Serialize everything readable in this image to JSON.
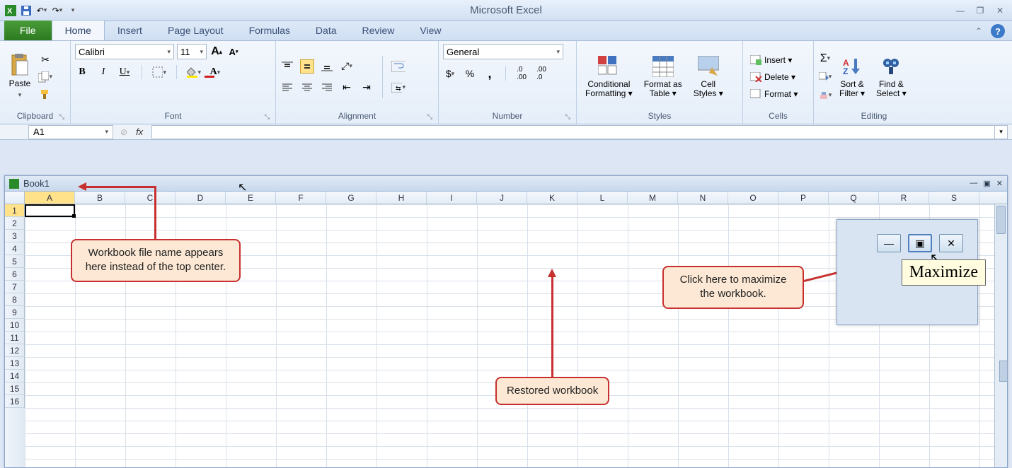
{
  "app": {
    "title": "Microsoft Excel"
  },
  "tabs": {
    "file": "File",
    "items": [
      "Home",
      "Insert",
      "Page Layout",
      "Formulas",
      "Data",
      "Review",
      "View"
    ],
    "active": "Home"
  },
  "ribbon": {
    "clipboard": {
      "paste": "Paste",
      "label": "Clipboard"
    },
    "font": {
      "name": "Calibri",
      "size": "11",
      "label": "Font"
    },
    "alignment": {
      "label": "Alignment"
    },
    "number": {
      "format": "General",
      "label": "Number"
    },
    "styles": {
      "conditional": "Conditional\nFormatting ▾",
      "format_table": "Format as\nTable ▾",
      "cell_styles": "Cell\nStyles ▾",
      "label": "Styles"
    },
    "cells": {
      "insert": "Insert ▾",
      "delete": "Delete ▾",
      "format": "Format ▾",
      "label": "Cells"
    },
    "editing": {
      "sort": "Sort &\nFilter ▾",
      "find": "Find &\nSelect ▾",
      "label": "Editing"
    }
  },
  "formula_bar": {
    "name_box": "A1",
    "fx": "fx"
  },
  "workbook": {
    "title": "Book1",
    "columns": [
      "A",
      "B",
      "C",
      "D",
      "E",
      "F",
      "G",
      "H",
      "I",
      "J",
      "K",
      "L",
      "M",
      "N",
      "O",
      "P",
      "Q",
      "R",
      "S"
    ],
    "rows": [
      "1",
      "2",
      "3",
      "4",
      "5",
      "6",
      "7",
      "8",
      "9",
      "10",
      "11",
      "12",
      "13",
      "14",
      "15",
      "16"
    ]
  },
  "callouts": {
    "filename": "Workbook file name appears\nhere instead of the top center.",
    "restored": "Restored workbook",
    "maximize_hint": "Click here to maximize\nthe workbook.",
    "tooltip": "Maximize"
  }
}
